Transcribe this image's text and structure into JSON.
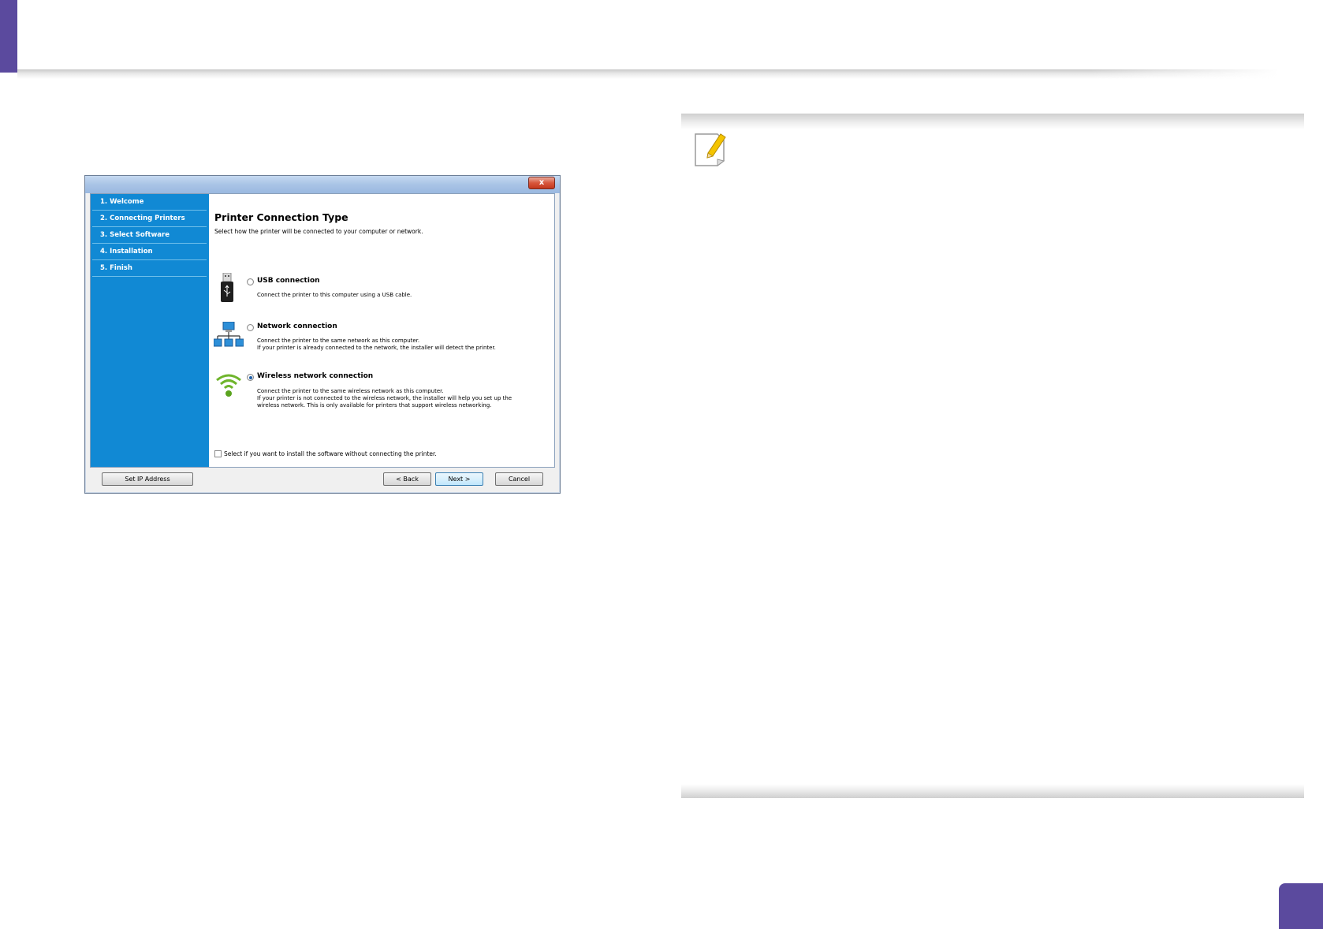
{
  "dialog": {
    "close_glyph": "x",
    "steps": [
      {
        "label": "1. Welcome"
      },
      {
        "label": "2. Connecting Printers"
      },
      {
        "label": "3. Select Software"
      },
      {
        "label": "4. Installation"
      },
      {
        "label": "5. Finish"
      }
    ],
    "heading": "Printer Connection Type",
    "subheading": "Select how the printer will be connected to your computer or network.",
    "options": [
      {
        "label": "USB connection",
        "icon": "usb-icon",
        "selected": false,
        "desc": [
          "Connect the printer to this computer using a USB cable."
        ]
      },
      {
        "label": "Network connection",
        "icon": "network-icon",
        "selected": false,
        "desc": [
          "Connect the printer to the same network as this computer.",
          "If your printer is already connected to the network, the installer will detect the printer."
        ]
      },
      {
        "label": "Wireless network connection",
        "icon": "wifi-icon",
        "selected": true,
        "desc": [
          "Connect the printer to the same wireless network as this computer.",
          "If your printer is not connected to the wireless network, the installer will help you set up the",
          "wireless network. This is only available for printers that support wireless networking."
        ]
      }
    ],
    "checkbox_label": "Select if you want to install the software without connecting the printer.",
    "checkbox_checked": false,
    "buttons": {
      "set_ip": "Set IP Address",
      "back": "< Back",
      "next": "Next >",
      "cancel": "Cancel"
    }
  },
  "colors": {
    "accent": "#5b4a9e",
    "sidebar": "#1189d4"
  },
  "note": {
    "icon": "note-pencil-icon"
  }
}
